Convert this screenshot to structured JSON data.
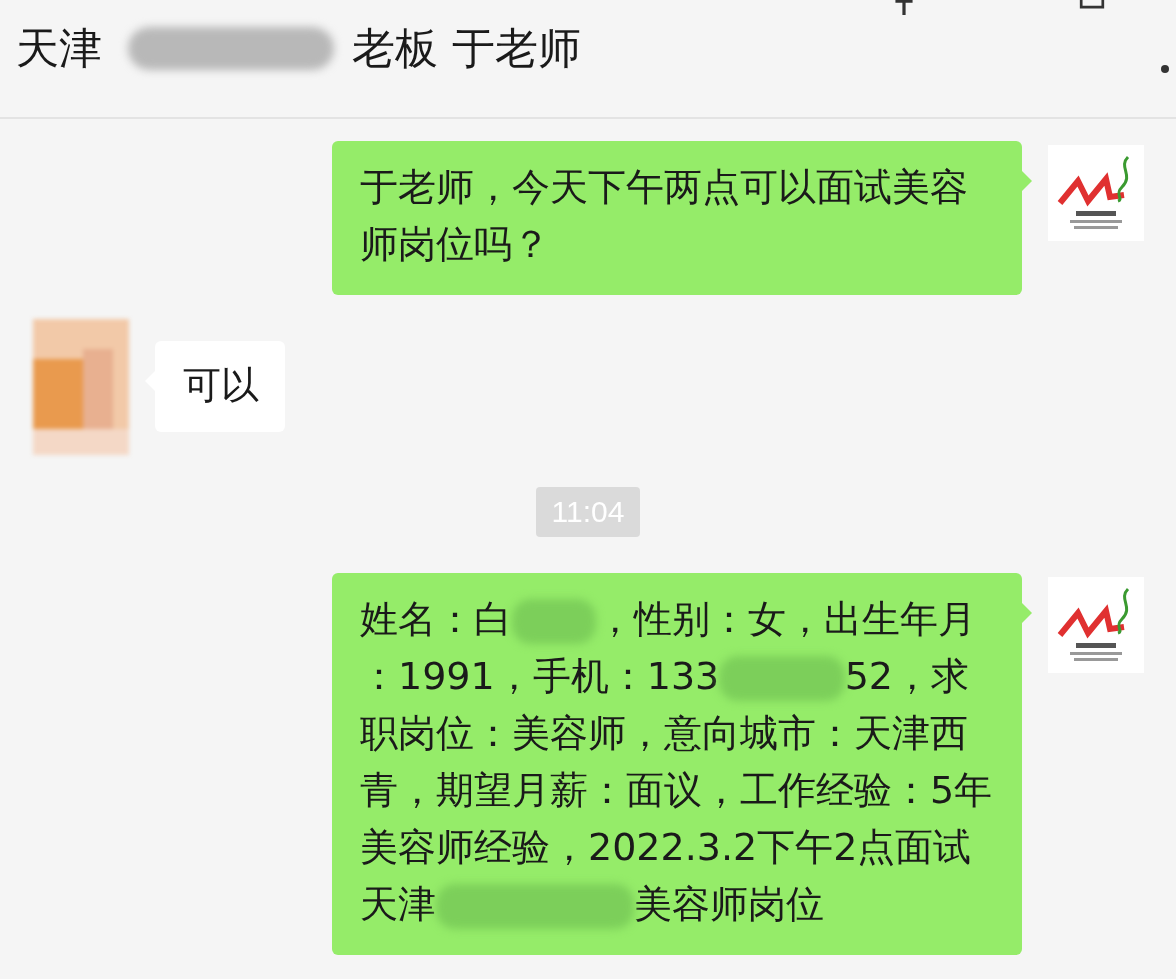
{
  "header": {
    "title": [
      {
        "kind": "text",
        "text": "天津"
      },
      {
        "kind": "blur"
      },
      {
        "kind": "text",
        "text": "老板 于老师"
      }
    ]
  },
  "messages": [
    {
      "kind": "text",
      "from_me": true,
      "parts": [
        {
          "kind": "text",
          "text": "于老师，今天下午两点可以面试美容师岗位吗？"
        }
      ]
    },
    {
      "kind": "text",
      "from_me": false,
      "parts": [
        {
          "kind": "text",
          "text": "可以"
        }
      ]
    },
    {
      "kind": "time",
      "text": "11:04"
    },
    {
      "kind": "text",
      "from_me": true,
      "parts": [
        {
          "kind": "text",
          "text": "姓名：白"
        },
        {
          "kind": "blur"
        },
        {
          "kind": "text",
          "text": "，性别：女，出生年月：1991，手机：133"
        },
        {
          "kind": "blur"
        },
        {
          "kind": "text",
          "text": "52，求职岗位：美容师，意向城市：天津西青，期望月薪：面议，工作经验：5年美容师经验，2022.3.2下午2点面试天津"
        },
        {
          "kind": "blur"
        },
        {
          "kind": "text",
          "text": "美容师岗位"
        }
      ]
    }
  ]
}
